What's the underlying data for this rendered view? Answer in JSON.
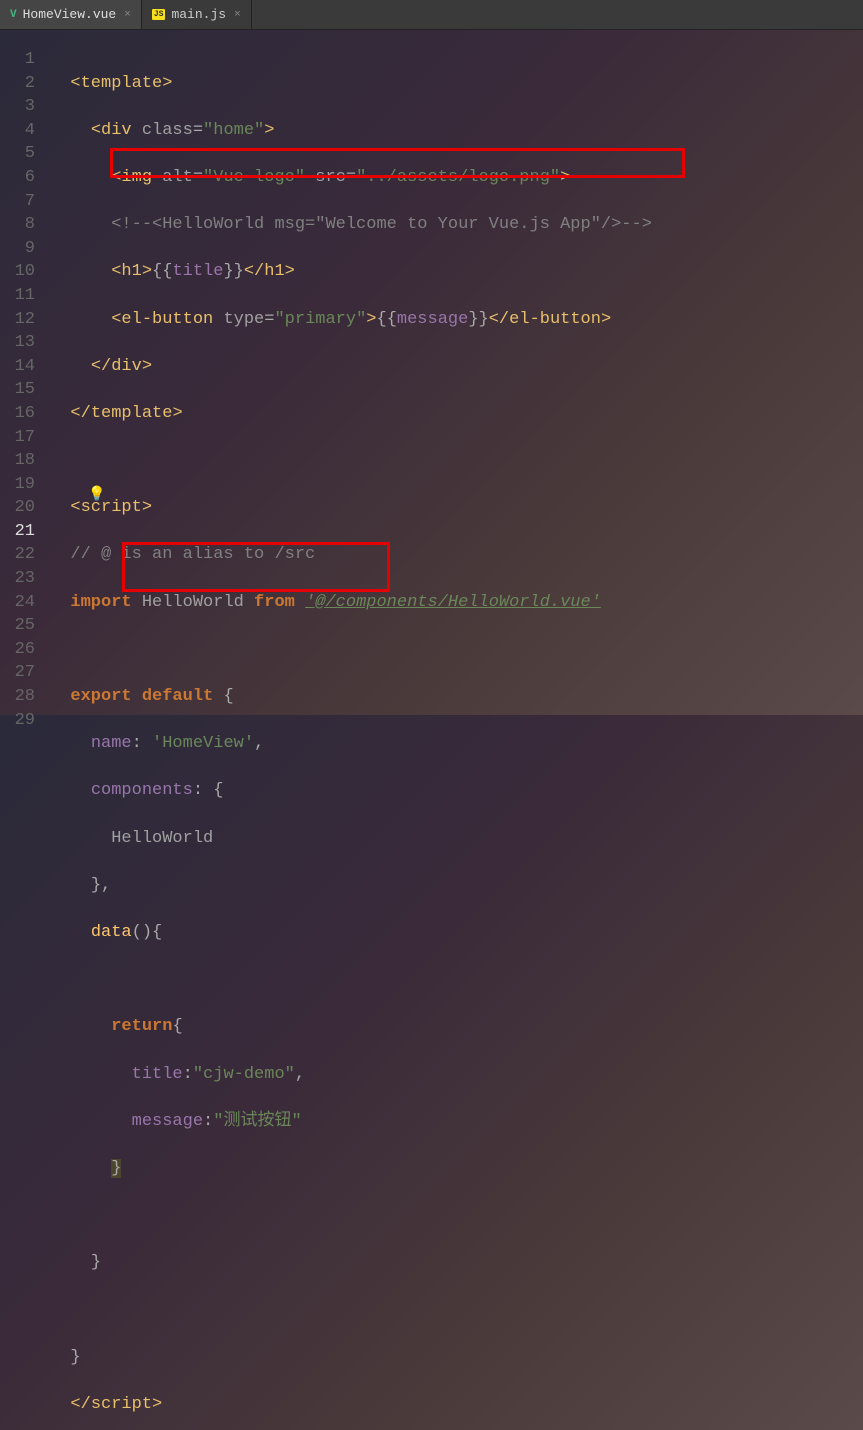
{
  "tabs": {
    "active": {
      "icon": "V",
      "name": "HomeView.vue",
      "close": "×"
    },
    "other": {
      "icon": "JS",
      "name": "main.js",
      "close": "×"
    }
  },
  "gutter": {
    "1": "1",
    "2": "2",
    "3": "3",
    "4": "4",
    "5": "5",
    "6": "6",
    "7": "7",
    "8": "8",
    "9": "9",
    "10": "10",
    "11": "11",
    "12": "12",
    "13": "13",
    "14": "14",
    "15": "15",
    "16": "16",
    "17": "17",
    "18": "18",
    "19": "19",
    "20": "20",
    "21": "21",
    "22": "22",
    "23": "23",
    "24": "24",
    "25": "25",
    "26": "26",
    "27": "27",
    "28": "28",
    "29": "29"
  },
  "code": {
    "l1": {
      "o": "<",
      "t": "template",
      "c": ">"
    },
    "l2": {
      "o": "<",
      "t": "div ",
      "a": "class",
      "eq": "=",
      "v": "\"home\"",
      "c": ">"
    },
    "l3": {
      "o": "<",
      "t": "img ",
      "a1": "alt",
      "eq1": "=",
      "v1": "\"Vue logo\" ",
      "a2": "src",
      "eq2": "=",
      "v2": "\"../assets/logo.png\"",
      "c": ">"
    },
    "l4": {
      "c": "<!--<HelloWorld msg=\"Welcome to Your Vue.js App\"/>-->"
    },
    "l5": {
      "o1": "<",
      "t1": "h1",
      "c1": ">",
      "e1": "{{",
      "v": "title",
      "e2": "}}",
      "o2": "</",
      "t2": "h1",
      "c2": ">"
    },
    "l6": {
      "o1": "<",
      "t1": "el-button ",
      "a": "type",
      "eq": "=",
      "v": "\"primary\"",
      "c1": ">",
      "e1": "{{",
      "m": "message",
      "e2": "}}",
      "o2": "</",
      "t2": "el-button",
      "c2": ">"
    },
    "l7": {
      "o": "</",
      "t": "div",
      "c": ">"
    },
    "l8": {
      "o": "</",
      "t": "template",
      "c": ">"
    },
    "l10": {
      "o": "<",
      "t": "script",
      "c": ">"
    },
    "l11": {
      "c": "// @ is an alias to /src"
    },
    "l12": {
      "k": "import ",
      "i": "HelloWorld ",
      "f": "from ",
      "p": "'@/components/HelloWorld.vue'"
    },
    "l14": {
      "k1": "export ",
      "k2": "default ",
      "b": "{"
    },
    "l15": {
      "n": "name",
      "c": ": ",
      "v": "'HomeView'",
      "e": ","
    },
    "l16": {
      "n": "components",
      "c": ": {"
    },
    "l17": {
      "i": "HelloWorld"
    },
    "l18": {
      "c": "},"
    },
    "l19": {
      "n": "data",
      "p": "(){"
    },
    "l21": {
      "k": "return",
      "b": "{"
    },
    "l22": {
      "n": "title",
      "c": ":",
      "v": "\"cjw-demo\"",
      "e": ","
    },
    "l23": {
      "n": "message",
      "c": ":",
      "v": "\"测试按钮\""
    },
    "l24": {
      "b": "}"
    },
    "l26": {
      "b": "}"
    },
    "l28": {
      "b": "}"
    },
    "l29": {
      "o": "</",
      "t": "script",
      "c": ">"
    }
  }
}
